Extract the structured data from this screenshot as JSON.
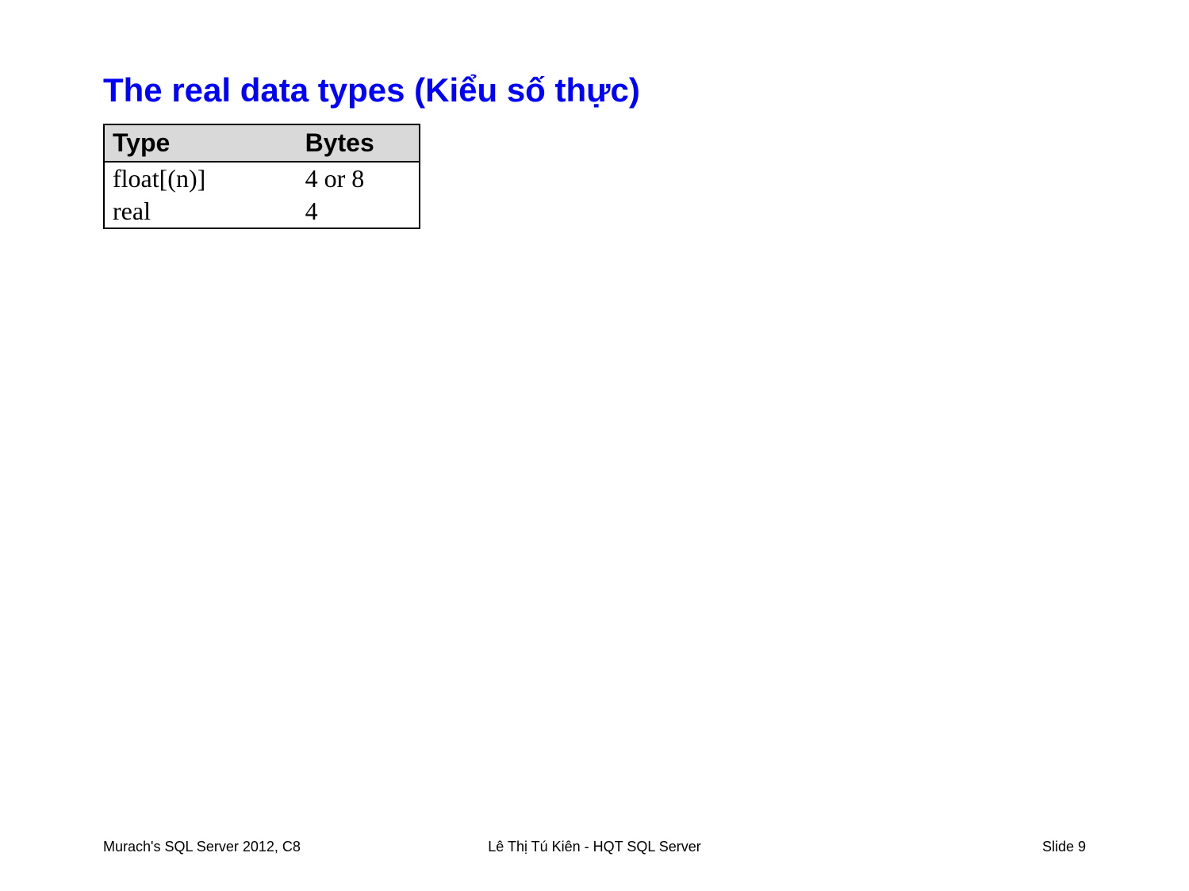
{
  "title": "The real data types (Kiểu số thực)",
  "table": {
    "headers": {
      "type": "Type",
      "bytes": "Bytes"
    },
    "rows": [
      {
        "type": "float[(n)]",
        "bytes": "4 or 8"
      },
      {
        "type": "real",
        "bytes": "4"
      }
    ]
  },
  "footer": {
    "left": "Murach's SQL Server 2012, C8",
    "center": "Lê Thị Tú Kiên - HQT SQL Server",
    "right": "Slide 9"
  }
}
